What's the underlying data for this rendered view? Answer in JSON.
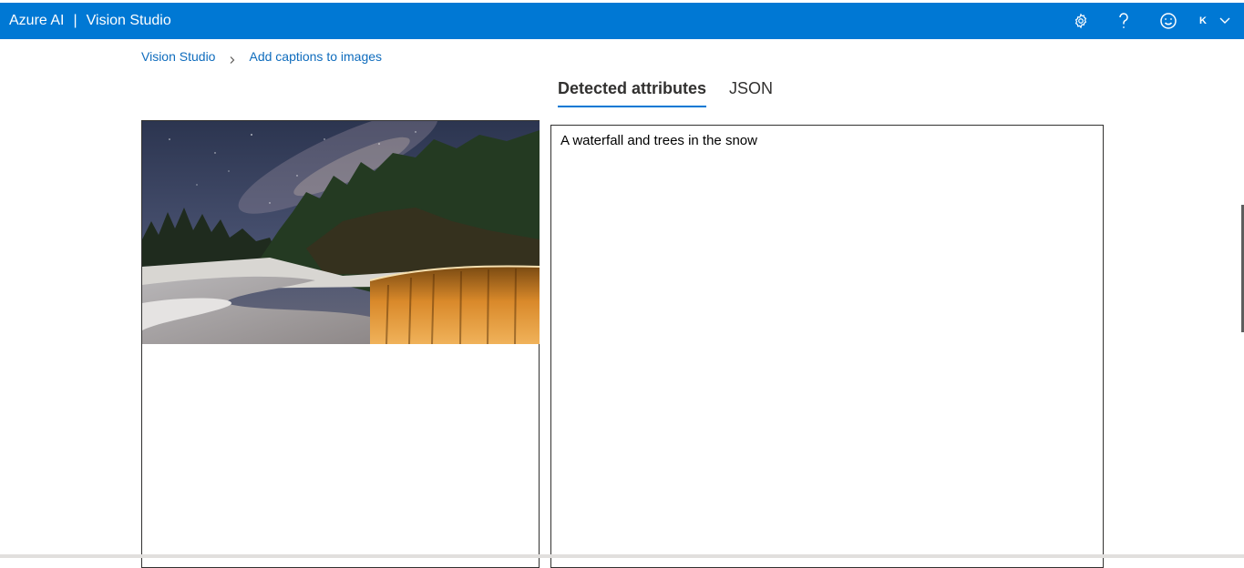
{
  "header": {
    "brand": "Azure AI",
    "separator": "|",
    "product": "Vision Studio",
    "icons": [
      "gear-icon",
      "help-icon",
      "feedback-smiley-icon",
      "chevron-down-icon"
    ],
    "avatar_letter": "K",
    "accent_color": "#0078d4"
  },
  "breadcrumb": {
    "items": [
      "Vision Studio",
      "Add captions to images"
    ]
  },
  "tabs": [
    {
      "label": "Detected attributes",
      "active": true
    },
    {
      "label": "JSON",
      "active": false
    }
  ],
  "result": {
    "caption": "A waterfall and trees in the snow"
  }
}
